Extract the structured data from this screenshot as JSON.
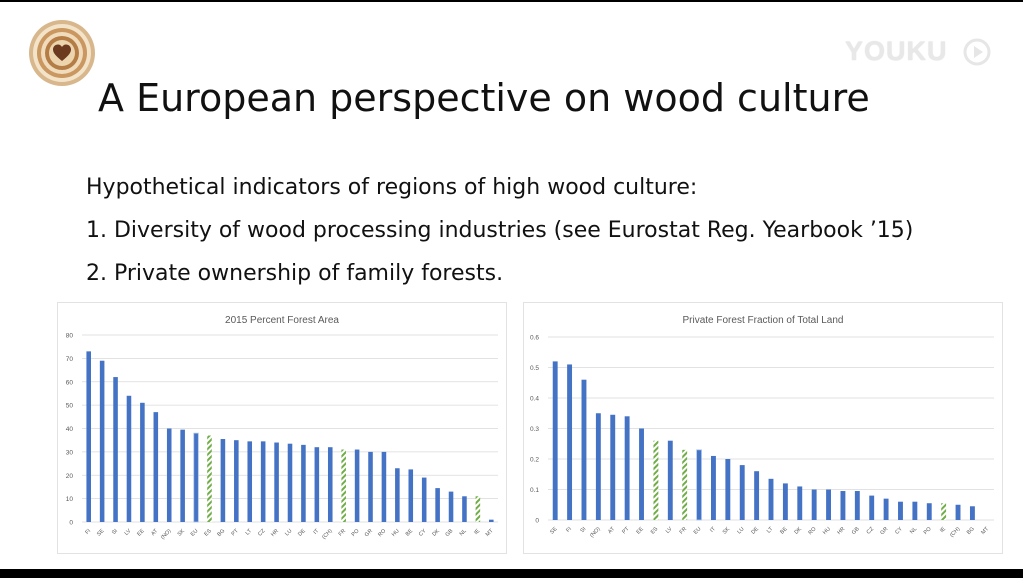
{
  "slide": {
    "title": "A European perspective on wood culture",
    "bullets": [
      "Hypothetical indicators of regions of high wood culture:",
      "1. Diversity of wood processing industries (see Eurostat Reg. Yearbook ’15)",
      "2. Private ownership of family forests."
    ],
    "watermark": "YOUKU",
    "logo_icon": "wood-rings-heart-icon"
  },
  "colors": {
    "bar": "#4472c4",
    "highlight_stripe": "#70ad47",
    "eu_bar": "#4472c4",
    "axis_text": "#595959",
    "grid": "#d9d9d9"
  },
  "chart_data": [
    {
      "type": "bar",
      "title": "2015 Percent Forest Area",
      "xlabel": "",
      "ylabel": "",
      "ylim": [
        0,
        80
      ],
      "yticks": [
        0,
        10,
        20,
        30,
        40,
        50,
        60,
        70,
        80
      ],
      "grid": true,
      "categories": [
        "FI",
        "SE",
        "SI",
        "LV",
        "EE",
        "AT",
        "(NO)",
        "SK",
        "EU",
        "ES",
        "BG",
        "PT",
        "LT",
        "CZ",
        "HR",
        "LU",
        "DE",
        "IT",
        "(CH)",
        "FR",
        "PO",
        "GR",
        "RO",
        "HU",
        "BE",
        "CY",
        "DK",
        "GB",
        "NL",
        "IE",
        "MT"
      ],
      "values": [
        73,
        69,
        62,
        54,
        51,
        47,
        40,
        39.5,
        38,
        37,
        35.5,
        35,
        34.5,
        34.5,
        34,
        33.5,
        33,
        32,
        32,
        31,
        31,
        30,
        30,
        23,
        22.5,
        19,
        14.5,
        13,
        11,
        11,
        1
      ],
      "styles": [
        "solid",
        "solid",
        "solid",
        "solid",
        "solid",
        "solid",
        "solid",
        "solid",
        "outline",
        "striped",
        "solid",
        "solid",
        "solid",
        "solid",
        "solid",
        "solid",
        "solid",
        "solid",
        "solid",
        "striped",
        "solid",
        "solid",
        "solid",
        "solid",
        "solid",
        "solid",
        "solid",
        "solid",
        "solid",
        "striped",
        "solid"
      ]
    },
    {
      "type": "bar",
      "title": "Private Forest Fraction of Total Land",
      "xlabel": "",
      "ylabel": "",
      "ylim": [
        0,
        0.6
      ],
      "yticks": [
        0,
        0.1,
        0.2,
        0.3,
        0.4,
        0.5,
        0.6
      ],
      "grid": true,
      "categories": [
        "SE",
        "FI",
        "SI",
        "(NO)",
        "AT",
        "PT",
        "EE",
        "ES",
        "LV",
        "FR",
        "EU",
        "IT",
        "SK",
        "LU",
        "DE",
        "LT",
        "BE",
        "DK",
        "RO",
        "HU",
        "HR",
        "GB",
        "CZ",
        "GR",
        "CY",
        "NL",
        "PO",
        "IE",
        "(CH)",
        "BG",
        "MT"
      ],
      "values": [
        0.52,
        0.51,
        0.46,
        0.35,
        0.345,
        0.34,
        0.3,
        0.26,
        0.26,
        0.23,
        0.23,
        0.21,
        0.2,
        0.18,
        0.16,
        0.135,
        0.12,
        0.11,
        0.1,
        0.1,
        0.095,
        0.095,
        0.08,
        0.07,
        0.06,
        0.06,
        0.055,
        0.055,
        0.05,
        0.045,
        0
      ],
      "styles": [
        "solid",
        "solid",
        "solid",
        "solid",
        "solid",
        "solid",
        "solid",
        "striped",
        "solid",
        "striped",
        "outline",
        "solid",
        "solid",
        "solid",
        "solid",
        "solid",
        "solid",
        "solid",
        "solid",
        "solid",
        "solid",
        "solid",
        "solid",
        "solid",
        "solid",
        "solid",
        "solid",
        "striped",
        "solid",
        "solid",
        "solid"
      ]
    }
  ]
}
